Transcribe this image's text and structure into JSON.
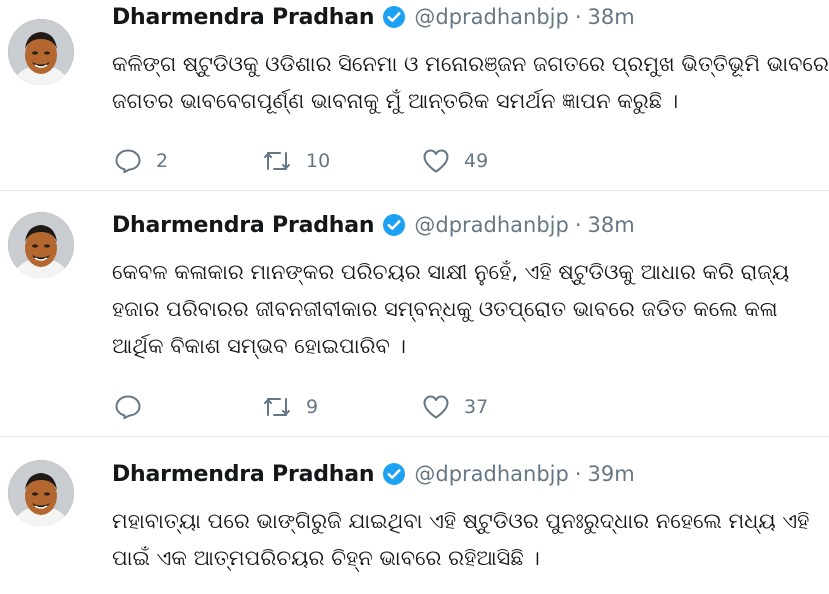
{
  "colors": {
    "text": "#14171a",
    "secondary": "#657786",
    "verified": "#1da1f2",
    "divider": "#e6ecf0"
  },
  "tweets": [
    {
      "author": "Dharmendra Pradhan",
      "handle": "@dpradhanbjp",
      "separator": "·",
      "time": "38m",
      "verified": true,
      "avatar": "avatar-photo",
      "lines": [
        "କଳିଙ୍ଗ ଷ୍ଟୁଡିଓକୁ ଓଡିଶାର ସିନେମା ଓ ମନୋରଞ୍ଜନ ଜଗତରେ ପ୍ରମୁଖ ଭିତ୍ତିଭୂମି ଭାବରେ",
        "ଜଗତର ଭାବବେଗପୂର୍ଣ୍ଣ ଭାବନାକୁ ମୁଁ ଆନ୍ତରିକ ସମର୍ଥନ ଜ୍ଞାପନ କରୁଛି ।"
      ],
      "replies": "2",
      "retweets": "10",
      "likes": "49"
    },
    {
      "author": "Dharmendra Pradhan",
      "handle": "@dpradhanbjp",
      "separator": "·",
      "time": "38m",
      "verified": true,
      "avatar": "avatar-photo",
      "lines": [
        "କେବଳ କଳାକାର ମାନଙ୍କର ପରିଚୟର ସାକ୍ଷୀ ନୁହେଁ, ଏହି ଷ୍ଟୁଡିଓକୁ ଆଧାର କରି ରାଜ୍ୟ",
        "ହଜାର ପରିବାରର ଜୀବନଜୀବୀକାର ସମ୍ବନ୍ଧକୁ ଓତପ୍ରୋତ ଭାବରେ ଜଡିତ କଲେ କଳା",
        "ଆର୍ଥିକ ବିକାଶ ସମ୍ଭବ ହୋଇପାରିବ ।"
      ],
      "replies": "",
      "retweets": "9",
      "likes": "37"
    },
    {
      "author": "Dharmendra Pradhan",
      "handle": "@dpradhanbjp",
      "separator": "·",
      "time": "39m",
      "verified": true,
      "avatar": "avatar-photo",
      "lines": [
        "ମହାବାତ୍ୟା ପରେ ଭାଙ୍ଗିରୁଜି ଯାଇଥିବା ଏହି  ଷ୍ଟୁଡିଓର ପୁନଃରୁଦ୍ଧାର ନହେଲେ ମଧ୍ୟ ଏହି",
        "ପାଇଁ ଏକ ଆତ୍ମପରିଚୟର ଚିହ୍ନ ଭାବରେ ରହିଆସିଛି ।"
      ]
    }
  ]
}
